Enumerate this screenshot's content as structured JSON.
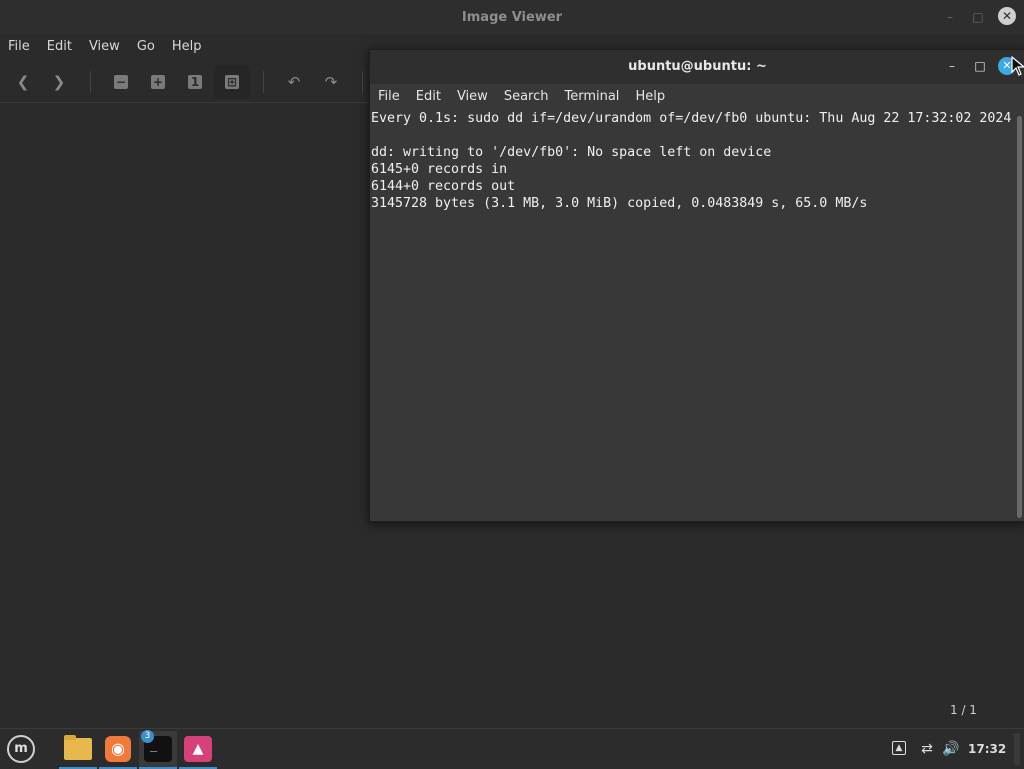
{
  "image_viewer": {
    "title": "Image Viewer",
    "menu": [
      "File",
      "Edit",
      "View",
      "Go",
      "Help"
    ],
    "toolbar": {
      "prev_icon": "chevron-left-icon",
      "next_icon": "chevron-right-icon",
      "zoom_out_icon": "zoom-out-icon",
      "zoom_in_icon": "zoom-in-icon",
      "zoom_normal_label": "1",
      "fit_icon": "zoom-fit-icon",
      "rotate_left_icon": "rotate-left-icon",
      "rotate_right_icon": "rotate-right-icon"
    },
    "page_count": "1 / 1"
  },
  "terminal": {
    "title": "ubuntu@ubuntu: ~",
    "menu": [
      "File",
      "Edit",
      "View",
      "Search",
      "Terminal",
      "Help"
    ],
    "lines": [
      "Every 0.1s: sudo dd if=/dev/urandom of=/dev/fb0 ubuntu: Thu Aug 22 17:32:02 2024",
      "",
      "dd: writing to '/dev/fb0': No space left on device",
      "6145+0 records in",
      "6144+0 records out",
      "3145728 bytes (3.1 MB, 3.0 MiB) copied, 0.0483849 s, 65.0 MB/s"
    ]
  },
  "taskbar": {
    "menu_label": "m",
    "apps": [
      {
        "name": "Files",
        "icon": "folder-icon"
      },
      {
        "name": "Firefox",
        "icon": "firefox-icon"
      },
      {
        "name": "Terminal",
        "icon": "terminal-icon",
        "badge": "3"
      },
      {
        "name": "Image Viewer",
        "icon": "image-viewer-icon"
      }
    ],
    "clock": "17:32"
  },
  "colors": {
    "accent": "#3ea8e0",
    "panel": "#2c2c2c",
    "window": "#2b2b2b",
    "terminal_bg": "#383838"
  }
}
